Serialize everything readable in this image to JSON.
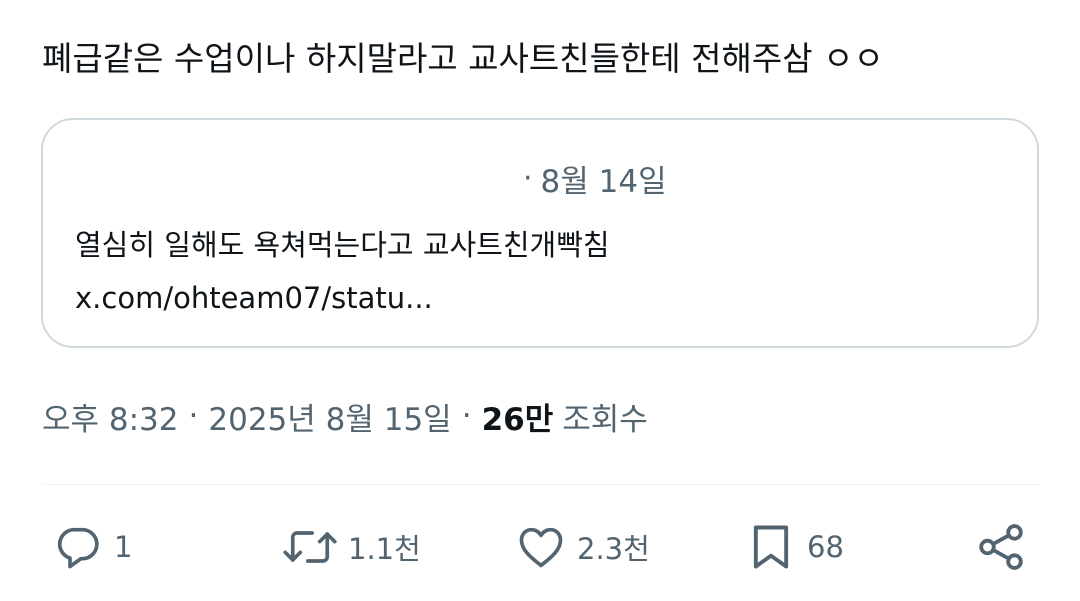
{
  "tweet": {
    "text": "폐급같은 수업이나 하지말라고 교사트친들한테 전해주삼 ㅇㅇ"
  },
  "quote": {
    "separator": "·",
    "date": "8월 14일",
    "text": "열심히 일해도 욕쳐먹는다고 교사트친개빡침",
    "link": "x.com/ohteam07/statu..."
  },
  "meta": {
    "time": "오후 8:32",
    "separator": "·",
    "date": "2025년 8월 15일",
    "views_count": "26만",
    "views_label": "조회수"
  },
  "actions": {
    "reply": {
      "icon": "reply-icon",
      "count": "1"
    },
    "retweet": {
      "icon": "retweet-icon",
      "count": "1.1천"
    },
    "like": {
      "icon": "heart-icon",
      "count": "2.3천"
    },
    "bookmark": {
      "icon": "bookmark-icon",
      "count": "68"
    },
    "share": {
      "icon": "share-icon"
    }
  },
  "colors": {
    "text_primary": "#0f1419",
    "text_secondary": "#536471",
    "border": "#cfd9de",
    "divider": "#eff3f4"
  }
}
